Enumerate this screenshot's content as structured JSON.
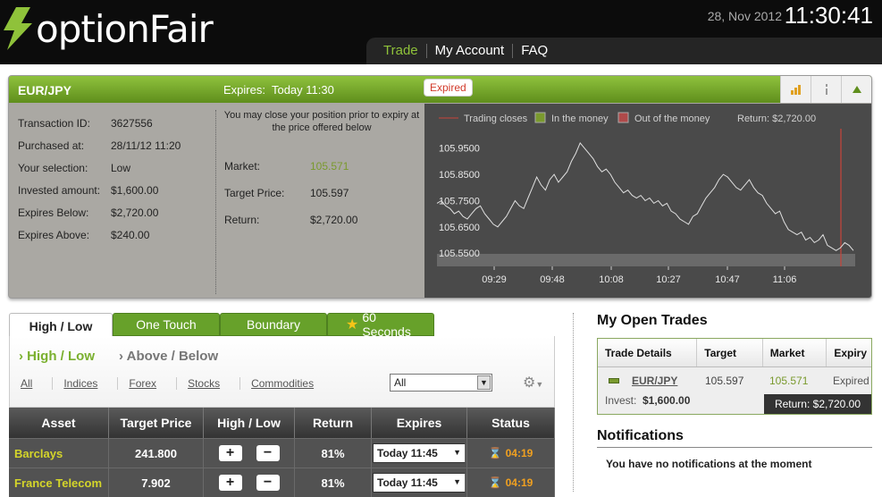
{
  "brand": {
    "name": "optionFair"
  },
  "header": {
    "date": "28, Nov 2012",
    "time": "11:30:41"
  },
  "nav": {
    "items": [
      "Trade",
      "My Account",
      "FAQ"
    ]
  },
  "trade": {
    "pair": "EUR/JPY",
    "expires_label": "Expires:",
    "expires_value": "Today 11:30",
    "status_badge": "Expired",
    "details": [
      {
        "label": "Transaction ID:",
        "value": "3627556"
      },
      {
        "label": "Purchased at:",
        "value": "28/11/12 11:20"
      },
      {
        "label": "Your selection:",
        "value": "Low"
      },
      {
        "label": "Invested amount:",
        "value": "$1,600.00"
      },
      {
        "label": "Expires Below:",
        "value": "$2,720.00"
      },
      {
        "label": "Expires Above:",
        "value": "$240.00"
      }
    ],
    "close_note": "You may close your position prior to expiry at the price offered below",
    "market": {
      "label": "Market:",
      "value": "105.571"
    },
    "target": {
      "label": "Target Price:",
      "value": "105.597"
    },
    "return": {
      "label": "Return:",
      "value": "$2,720.00"
    }
  },
  "chart_data": {
    "type": "line",
    "legend": [
      "Trading closes",
      "In the money",
      "Out of the money"
    ],
    "return_label": "Return: $2,720.00",
    "y_ticks": [
      "105.9500",
      "105.8500",
      "105.7500",
      "105.6500",
      "105.5500"
    ],
    "x_ticks": [
      "09:29",
      "09:48",
      "10:08",
      "10:27",
      "10:47",
      "11:06"
    ],
    "ylim": [
      105.52,
      105.99
    ],
    "colors": {
      "line": "#e0e0e0",
      "in_money": "#7a9a2e",
      "out_money": "#b04a4a",
      "closes": "#c8443a"
    },
    "series": [
      {
        "values": [
          105.74,
          105.75,
          105.73,
          105.72,
          105.7,
          105.71,
          105.69,
          105.68,
          105.7,
          105.72,
          105.73,
          105.7,
          105.68,
          105.66,
          105.65,
          105.67,
          105.69,
          105.72,
          105.75,
          105.73,
          105.72,
          105.76,
          105.8,
          105.84,
          105.81,
          105.79,
          105.83,
          105.85,
          105.82,
          105.84,
          105.86,
          105.9,
          105.93,
          105.97,
          105.95,
          105.93,
          105.91,
          105.88,
          105.86,
          105.87,
          105.85,
          105.82,
          105.8,
          105.78,
          105.79,
          105.77,
          105.76,
          105.77,
          105.75,
          105.76,
          105.74,
          105.75,
          105.73,
          105.74,
          105.71,
          105.7,
          105.68,
          105.67,
          105.66,
          105.69,
          105.7,
          105.73,
          105.76,
          105.78,
          105.8,
          105.83,
          105.85,
          105.84,
          105.82,
          105.8,
          105.79,
          105.81,
          105.83,
          105.8,
          105.78,
          105.77,
          105.74,
          105.72,
          105.7,
          105.71,
          105.67,
          105.64,
          105.63,
          105.62,
          105.63,
          105.6,
          105.61,
          105.59,
          105.6,
          105.62,
          105.58,
          105.57,
          105.56,
          105.57,
          105.59,
          105.58,
          105.56
        ]
      }
    ]
  },
  "market_tabs": [
    "High / Low",
    "One Touch",
    "Boundary",
    "60 Seconds"
  ],
  "sub_tabs": [
    "High / Low",
    "Above / Below"
  ],
  "filters": [
    "All",
    "Indices",
    "Forex",
    "Stocks",
    "Commodities"
  ],
  "filter_select": "All",
  "table": {
    "headers": [
      "Asset",
      "Target Price",
      "High / Low",
      "Return",
      "Expires",
      "Status"
    ],
    "rows": [
      {
        "asset": "Barclays",
        "target": "241.800",
        "return": "81%",
        "expires": "Today 11:45",
        "status": "04:19"
      },
      {
        "asset": "France Telecom",
        "target": "7.902",
        "return": "81%",
        "expires": "Today 11:45",
        "status": "04:19"
      }
    ]
  },
  "open_trades": {
    "title": "My Open Trades",
    "headers": [
      "Trade Details",
      "Target",
      "Market",
      "Expiry"
    ],
    "row": {
      "pair": "EUR/JPY",
      "target": "105.597",
      "market": "105.571",
      "expiry": "Expired",
      "invest_label": "Invest:",
      "invest_value": "$1,600.00",
      "return": "Return: $2,720.00"
    }
  },
  "notifications": {
    "title": "Notifications",
    "message": "You have no notifications at the moment"
  }
}
